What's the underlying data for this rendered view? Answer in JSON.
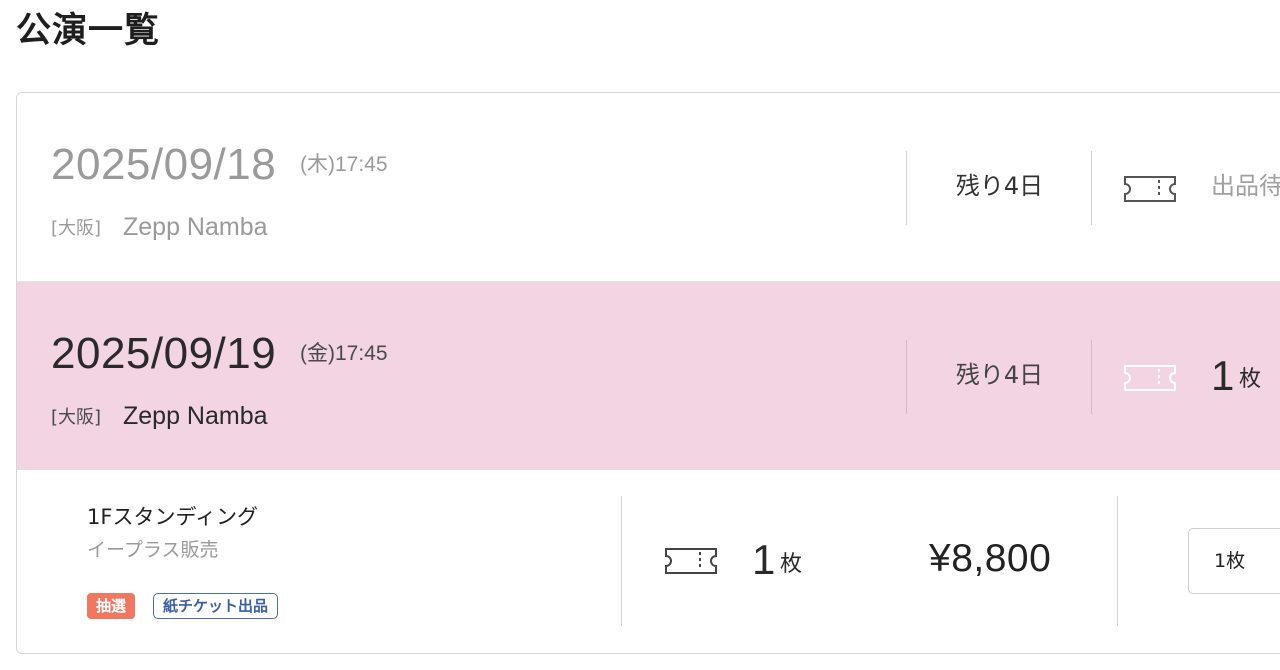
{
  "page": {
    "title": "公演一覧"
  },
  "events": [
    {
      "date": "2025/09/18",
      "weekday_time": "(木)17:45",
      "prefecture": "[大阪]",
      "venue": "Zepp Namba",
      "remaining": "残り4日",
      "status": "出品待"
    },
    {
      "date": "2025/09/19",
      "weekday_time": "(金)17:45",
      "prefecture": "[大阪]",
      "venue": "Zepp Namba",
      "remaining": "残り4日",
      "count": "1",
      "count_unit": "枚"
    }
  ],
  "listing": {
    "seat": "1Fスタンディング",
    "seller": "イープラス販売",
    "tags": [
      "抽選",
      "紙チケット出品"
    ],
    "count": "1",
    "count_unit": "枚",
    "price": "¥8,800",
    "quantity_select_value": "1枚"
  },
  "colors": {
    "selected_row_bg": "#f2d4e2",
    "lottery_tag_bg": "#f07860",
    "paper_tag_border": "#4a6fb8"
  },
  "icons": {
    "ticket": "ticket-icon"
  }
}
